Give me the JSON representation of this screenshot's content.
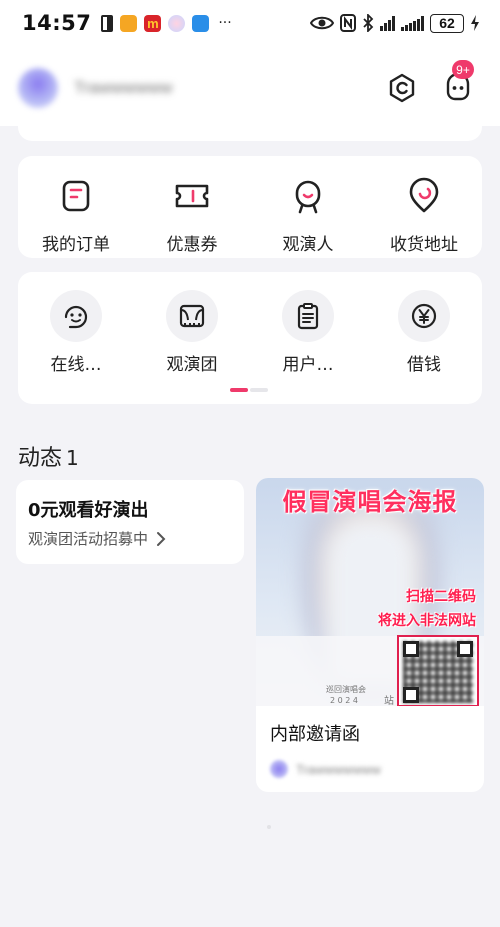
{
  "status_bar": {
    "time": "14:57",
    "battery": "62",
    "more": "···"
  },
  "profile": {
    "username": "Trawwwwww",
    "notification_badge": "9+"
  },
  "quick_grid": {
    "items": [
      {
        "label": "我的订单",
        "icon": "order-icon"
      },
      {
        "label": "优惠券",
        "icon": "coupon-icon"
      },
      {
        "label": "观演人",
        "icon": "attendee-icon"
      },
      {
        "label": "收货地址",
        "icon": "location-icon"
      }
    ]
  },
  "service_grid": {
    "items": [
      {
        "label": "在线…",
        "icon": "chat-service-icon"
      },
      {
        "label": "观演团",
        "icon": "theater-group-icon"
      },
      {
        "label": "用户…",
        "icon": "clipboard-icon"
      },
      {
        "label": "借钱",
        "icon": "yen-icon"
      }
    ],
    "pager": {
      "pages": 2,
      "active": 0
    }
  },
  "feed": {
    "title": "动态",
    "count": "1",
    "promo": {
      "title": "0元观看好演出",
      "subtitle": "观演团活动招募中"
    },
    "post": {
      "poster_headline": "假冒演唱会海报",
      "poster_warning_1": "扫描二维码",
      "poster_warning_2": "将进入非法网站",
      "poster_small_1": "巡回演唱会",
      "poster_small_2": "2 0 2 4",
      "poster_small_3": "站",
      "title": "内部邀请函",
      "author": "Trawwwwwww"
    }
  },
  "colors": {
    "accent": "#ef3a6b",
    "background": "#f3f3f7",
    "card": "#ffffff"
  }
}
